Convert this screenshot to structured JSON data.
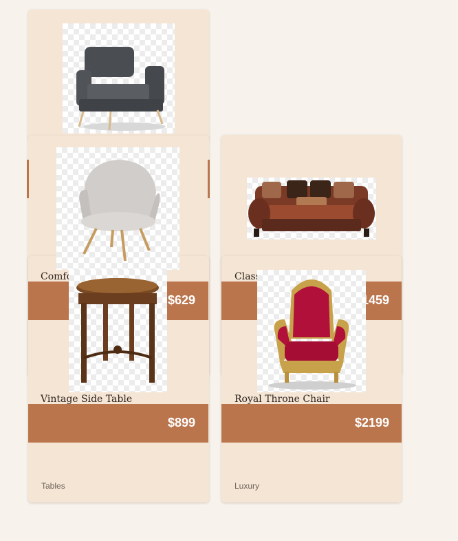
{
  "products": [
    {
      "name": "Comfort Armchair",
      "price": "$629"
    },
    {
      "name": "Classic Sofa",
      "price": "$1459"
    },
    {
      "name": "Vintage Side Table",
      "price": "$899",
      "category": "Tables"
    },
    {
      "name": "Royal Throne Chair",
      "price": "$2199",
      "category": "Luxury"
    }
  ],
  "images": [
    {
      "icon": "gray-armchair-image"
    },
    {
      "icon": "white-modern-chair-image"
    },
    {
      "icon": "brown-sofa-image"
    },
    {
      "icon": "wooden-side-table-image"
    },
    {
      "icon": "red-throne-chair-image"
    }
  ],
  "colors": {
    "page_bg": "#f7f2ec",
    "card_bg": "#f5e5d4",
    "price_band": "#bb754d",
    "text": "#2a211c"
  }
}
